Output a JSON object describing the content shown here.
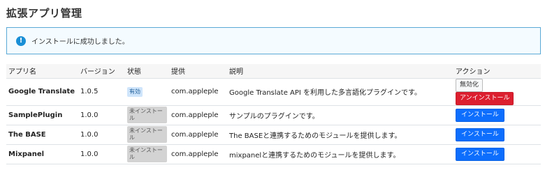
{
  "page": {
    "title": "拡張アプリ管理"
  },
  "alert": {
    "icon": "info-icon",
    "message": "インストールに成功しました。"
  },
  "table": {
    "headers": {
      "name": "アプリ名",
      "version": "バージョン",
      "status": "状態",
      "provider": "提供",
      "description": "説明",
      "action": "アクション"
    },
    "rows": [
      {
        "name": "Google Translate",
        "version": "1.0.5",
        "status": "有効",
        "provider": "com.appleple",
        "description": "Google Translate API を利用した多言語化プラグインです。",
        "actions": [
          "無効化",
          "アンインストール"
        ]
      },
      {
        "name": "SamplePlugin",
        "version": "1.0.0",
        "status": "未インストール",
        "provider": "com.appleple",
        "description": "サンプルのプラグインです。",
        "actions": [
          "インストール"
        ]
      },
      {
        "name": "The BASE",
        "version": "1.0.0",
        "status": "未インストール",
        "provider": "com.appleple",
        "description": "The BASEと連携するためのモジュールを提供します。",
        "actions": [
          "インストール"
        ]
      },
      {
        "name": "Mixpanel",
        "version": "1.0.0",
        "status": "未インストール",
        "provider": "com.appleple",
        "description": "mixpanelと連携するためのモジュールを提供します。",
        "actions": [
          "インストール"
        ]
      }
    ]
  },
  "colors": {
    "primary": "#0d6efd",
    "danger": "#dc1f2f",
    "alert_border": "#5aa9d6",
    "info_icon": "#1a8fd6",
    "badge_active": "#cfe5fb",
    "badge_inactive": "#d3d3d3"
  }
}
